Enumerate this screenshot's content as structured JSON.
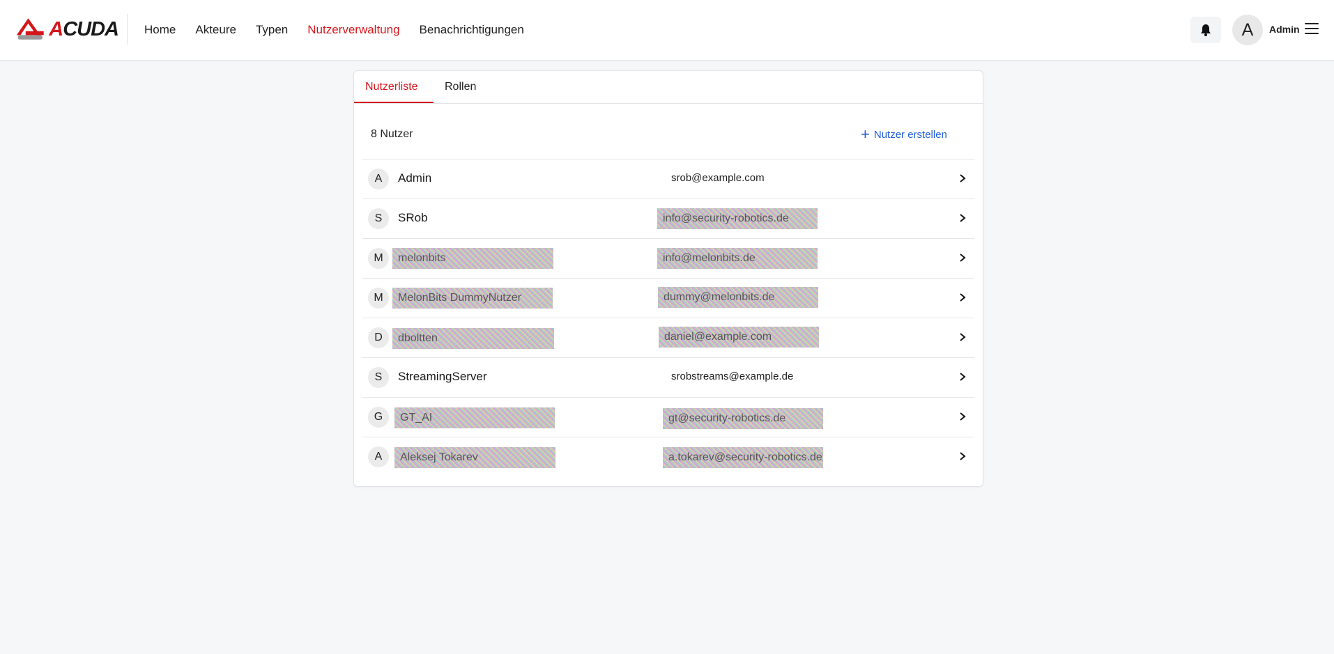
{
  "app": {
    "logo_text_first": "A",
    "logo_text_rest": "CUDA"
  },
  "nav": {
    "items": [
      {
        "label": "Home",
        "active": false
      },
      {
        "label": "Akteure",
        "active": false
      },
      {
        "label": "Typen",
        "active": false
      },
      {
        "label": "Nutzerverwaltung",
        "active": true
      },
      {
        "label": "Benachrichtigungen",
        "active": false
      }
    ]
  },
  "header": {
    "avatar_letter": "A",
    "user_name": "Admin",
    "bell_icon": "bell-icon",
    "menu_icon": "hamburger-menu-icon"
  },
  "tabs": [
    {
      "label": "Nutzerliste",
      "active": true
    },
    {
      "label": "Rollen",
      "active": false
    }
  ],
  "list": {
    "count_label": "8 Nutzer",
    "create_label": "Nutzer erstellen",
    "users": [
      {
        "initial": "A",
        "name": "Admin",
        "email": "srob@example.com",
        "redacted": false
      },
      {
        "initial": "S",
        "name": "SRob",
        "email": "info@security-robotics.de",
        "redacted": true
      },
      {
        "initial": "M",
        "name": "melonbits",
        "email": "info@melonbits.de",
        "redacted": true
      },
      {
        "initial": "M",
        "name": "MelonBits DummyNutzer",
        "email": "dummy@melonbits.de",
        "redacted": true
      },
      {
        "initial": "D",
        "name": "dboltten",
        "email": "daniel@example.com",
        "redacted": true
      },
      {
        "initial": "S",
        "name": "StreamingServer",
        "email": "srobstreams@example.de",
        "redacted": false
      },
      {
        "initial": "G",
        "name": "GT_AI",
        "email": "gt@security-robotics.de",
        "redacted": true
      },
      {
        "initial": "A",
        "name": "Aleksej Tokarev",
        "email": "a.tokarev@security-robotics.de",
        "redacted": true
      }
    ]
  },
  "colors": {
    "accent": "#d4161b",
    "link": "#1e5bd8"
  }
}
